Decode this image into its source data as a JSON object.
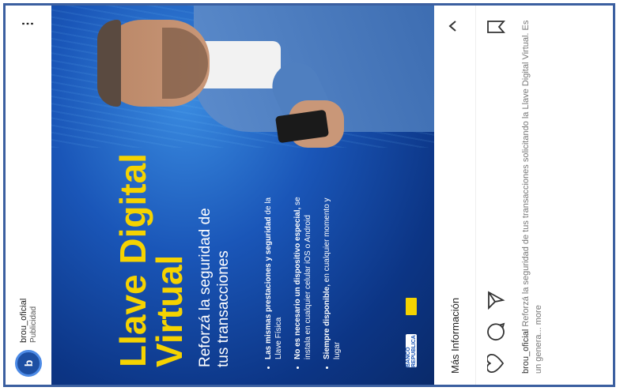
{
  "post": {
    "username": "brou_oficial",
    "subtitle": "Publicidad",
    "avatar_letter": "b",
    "more_icon": "more-options-icon"
  },
  "ad": {
    "title_line1": "Llave Digital",
    "title_line2": "Virtual",
    "subtitle": "Reforzá la seguridad de tus transacciones",
    "bullets": [
      {
        "bold": "Las mismas prestaciones y seguridad",
        "rest": " de la Llave Física"
      },
      {
        "bold": "No es necesario un dispositivo especial,",
        "rest": " se instala en cualquier celular iOS o Android"
      },
      {
        "bold": "Siempre disponible,",
        "rest": " en cualquier momento y lugar"
      }
    ],
    "brand_text": "BANCO REPUBLICA"
  },
  "cta": {
    "label": "Más Información",
    "chevron_icon": "chevron-up-icon"
  },
  "actions": {
    "like_icon": "heart-icon",
    "comment_icon": "comment-icon",
    "share_icon": "send-icon",
    "save_icon": "bookmark-icon"
  },
  "caption": {
    "user": "brou_oficial",
    "text": " Reforzá la seguridad de tus transacciones solicitando la Llave Digital Virtual. Es un genera... more"
  },
  "colors": {
    "accent": "#f5d300",
    "brand_blue": "#1a56b8",
    "frame": "#3b5fa0"
  }
}
